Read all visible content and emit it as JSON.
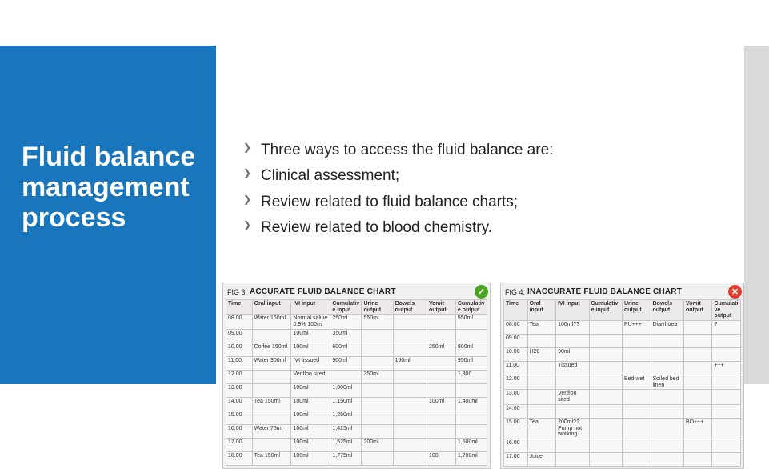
{
  "panel_title": "Fluid balance management process",
  "bullets": [
    "Three ways to access the fluid balance are:",
    "Clinical assessment;",
    "Review related to fluid balance charts;",
    "Review related to blood chemistry."
  ],
  "fig3": {
    "label": "FIG 3.",
    "title": "ACCURATE FLUID BALANCE CHART",
    "badge": "✓",
    "headers": [
      "Time",
      "Oral input",
      "IVI input",
      "Cumulative input",
      "Urine output",
      "Bowels output",
      "Vomit output",
      "Cumulative output"
    ],
    "rows": [
      [
        "08.00",
        "Water 150ml",
        "Normal saline 0.9% 100ml",
        "250ml",
        "550ml",
        "",
        "",
        "550ml"
      ],
      [
        "09.00",
        "",
        "100ml",
        "350ml",
        "",
        "",
        "",
        ""
      ],
      [
        "10.00",
        "Coffee 150ml",
        "100ml",
        "600ml",
        "",
        "",
        "250ml",
        "800ml"
      ],
      [
        "11.00",
        "Water 300ml",
        "IVI tissued",
        "900ml",
        "",
        "150ml",
        "",
        "950ml"
      ],
      [
        "12.00",
        "",
        "Venflon sited",
        "",
        "350ml",
        "",
        "",
        "1,300"
      ],
      [
        "13.00",
        "",
        "100ml",
        "1,000ml",
        "",
        "",
        "",
        ""
      ],
      [
        "14.00",
        "Tea 150ml",
        "100ml",
        "1,150ml",
        "",
        "",
        "100ml",
        "1,400ml"
      ],
      [
        "15.00",
        "",
        "100ml",
        "1,250ml",
        "",
        "",
        "",
        ""
      ],
      [
        "16.00",
        "Water 75ml",
        "100ml",
        "1,425ml",
        "",
        "",
        "",
        ""
      ],
      [
        "17.00",
        "",
        "100ml",
        "1,525ml",
        "200ml",
        "",
        "",
        "1,600ml"
      ],
      [
        "18.00",
        "Tea 150ml",
        "100ml",
        "1,775ml",
        "",
        "",
        "100",
        "1,700ml"
      ]
    ]
  },
  "fig4": {
    "label": "FIG 4.",
    "title": "INACCURATE FLUID BALANCE CHART",
    "badge": "✕",
    "headers": [
      "Time",
      "Oral input",
      "IVI input",
      "Cumulative input",
      "Urine output",
      "Bowels output",
      "Vomit output",
      "Cumulative output"
    ],
    "rows": [
      [
        "08.00",
        "Tea",
        "100ml??",
        "",
        "PU+++",
        "Diarrhoea",
        "",
        "?"
      ],
      [
        "09.00",
        "",
        "",
        "",
        "",
        "",
        "",
        ""
      ],
      [
        "10.00",
        "H20",
        "90ml",
        "",
        "",
        "",
        "",
        ""
      ],
      [
        "11.00",
        "",
        "Tissued",
        "",
        "",
        "",
        "",
        "+++"
      ],
      [
        "12.00",
        "",
        "",
        "",
        "Bed wet",
        "Soiled bed linen",
        "",
        ""
      ],
      [
        "13.00",
        "",
        "Venflon sited",
        "",
        "",
        "",
        "",
        ""
      ],
      [
        "14.00",
        "",
        "",
        "",
        "",
        "",
        "",
        ""
      ],
      [
        "15.00",
        "Tea",
        "200ml?? Pump not working",
        "",
        "",
        "",
        "BO+++",
        ""
      ],
      [
        "16.00",
        "",
        "",
        "",
        "",
        "",
        "",
        ""
      ],
      [
        "17.00",
        "Juice",
        "",
        "",
        "",
        "",
        "",
        ""
      ]
    ]
  }
}
